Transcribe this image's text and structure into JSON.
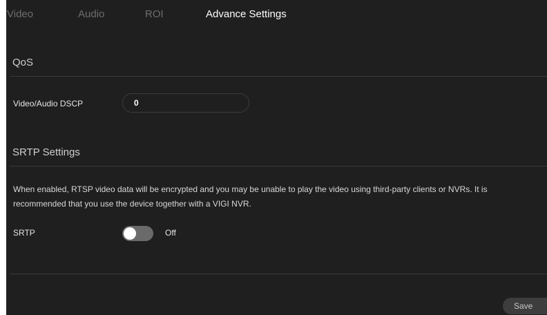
{
  "tabs": [
    {
      "label": "Video",
      "active": false
    },
    {
      "label": "Audio",
      "active": false
    },
    {
      "label": "ROI",
      "active": false
    },
    {
      "label": "Advance Settings",
      "active": true
    }
  ],
  "qos": {
    "title": "QoS",
    "dscp_label": "Video/Audio DSCP",
    "dscp_value": "0"
  },
  "srtp": {
    "title": "SRTP Settings",
    "description": "When enabled, RTSP video data will be encrypted and you may be unable to play the video using third-party clients or NVRs. It is recommended that you use the device together with a VIGI NVR.",
    "label": "SRTP",
    "enabled": false,
    "state_text": "Off"
  },
  "actions": {
    "save_label": "Save"
  },
  "colors": {
    "background": "#1f1f1f",
    "active_tab": "#ffffff",
    "inactive_tab": "#6e6e6e",
    "toggle_off": "#6a6a6a"
  },
  "icons": {
    "toggle": "toggle-switch-off"
  }
}
